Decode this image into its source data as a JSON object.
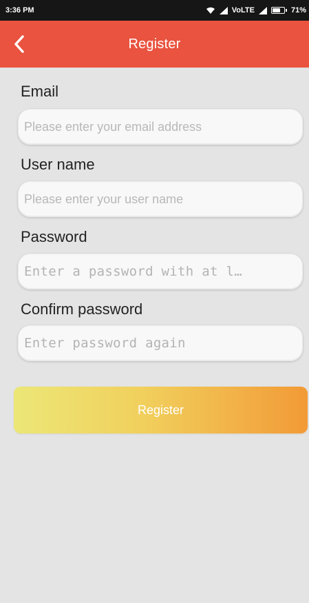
{
  "status_bar": {
    "time": "3:36 PM",
    "network": "VoLTE",
    "battery": "71%",
    "battery_level": 0.71
  },
  "header": {
    "back_icon": "chevron-left-icon",
    "title": "Register"
  },
  "form": {
    "email": {
      "label": "Email",
      "placeholder": "Please enter your email address",
      "value": ""
    },
    "username": {
      "label": "User name",
      "placeholder": "Please enter your user name",
      "value": ""
    },
    "password": {
      "label": "Password",
      "placeholder": "Enter a password with at l…",
      "value": ""
    },
    "confirm_password": {
      "label": "Confirm password",
      "placeholder": "Enter password again",
      "value": ""
    }
  },
  "register_button": {
    "label": "Register"
  },
  "colors": {
    "header": "#e9533f",
    "background": "#e4e4e4",
    "button_gradient_start": "#ece777",
    "button_gradient_end": "#f29a36"
  }
}
